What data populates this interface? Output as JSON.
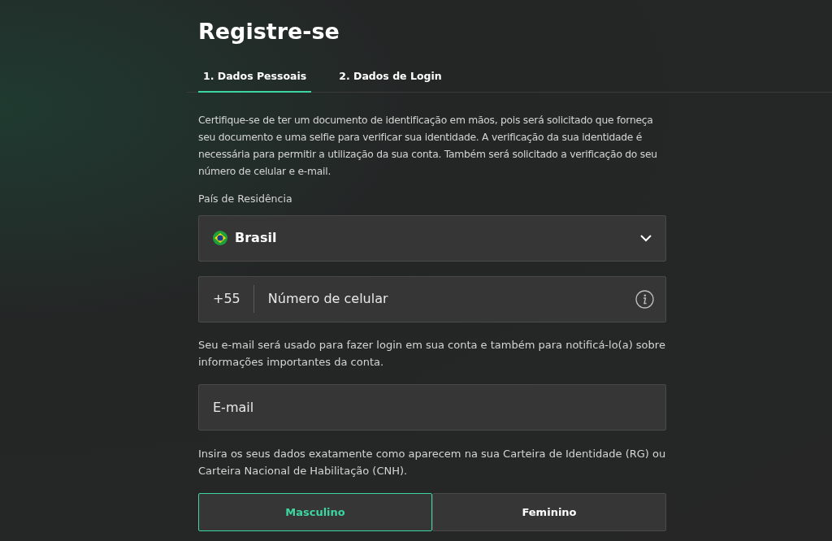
{
  "title": "Registre-se",
  "tabs": [
    {
      "label": "1. Dados Pessoais",
      "selected": true
    },
    {
      "label": "2. Dados de Login",
      "selected": false
    }
  ],
  "intro": "Certifique-se de ter um documento de identificação em mãos, pois será solicitado que forneça seu documento e uma selfie para verificar sua identidade. A verificação da sua identidade é necessária para permitir a utilização da sua conta. Também será solicitado a verificação do seu número de celular e e-mail.",
  "country": {
    "label": "País de Residência",
    "value": "Brasil"
  },
  "phone": {
    "prefix": "+55",
    "placeholder": "Número de celular"
  },
  "email_note": "Seu e-mail será usado para fazer login em sua conta e também para notificá-lo(a) sobre informações importantes da conta.",
  "email": {
    "placeholder": "E-mail"
  },
  "id_note": "Insira os seus dados exatamente como aparecem na sua Carteira de Identidade (RG) ou Carteira Nacional de Habilitação (CNH).",
  "gender": [
    {
      "label": "Masculino",
      "selected": true
    },
    {
      "label": "Feminino",
      "selected": false
    }
  ]
}
